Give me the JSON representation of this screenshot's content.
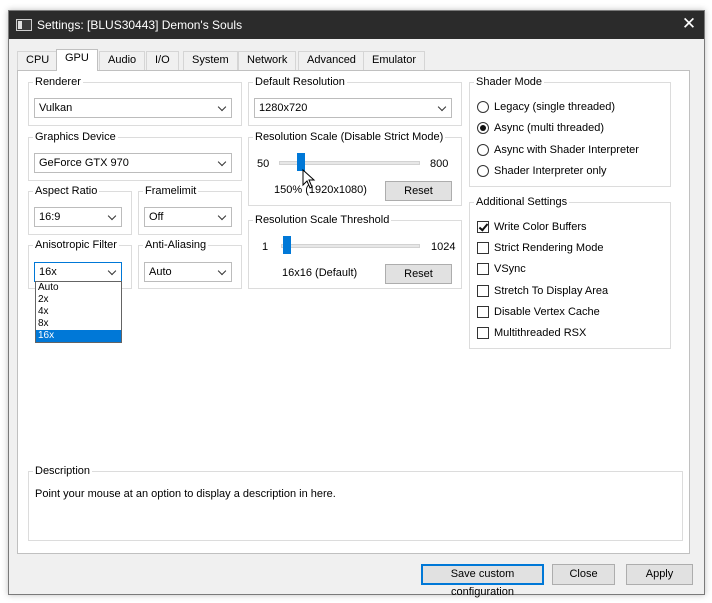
{
  "window": {
    "title": "Settings: [BLUS30443] Demon's Souls",
    "close_glyph": "✕"
  },
  "tabs": [
    {
      "label": "CPU"
    },
    {
      "label": "GPU",
      "active": true
    },
    {
      "label": "Audio"
    },
    {
      "label": "I/O"
    },
    {
      "label": "System"
    },
    {
      "label": "Network"
    },
    {
      "label": "Advanced"
    },
    {
      "label": "Emulator"
    }
  ],
  "renderer": {
    "legend": "Renderer",
    "value": "Vulkan"
  },
  "graphics_device": {
    "legend": "Graphics Device",
    "value": "GeForce GTX 970"
  },
  "aspect_ratio": {
    "legend": "Aspect Ratio",
    "value": "16:9"
  },
  "framelimit": {
    "legend": "Framelimit",
    "value": "Off"
  },
  "anisotropic_filter": {
    "legend": "Anisotropic Filter",
    "value": "16x",
    "options": [
      "Auto",
      "2x",
      "4x",
      "8x",
      "16x"
    ],
    "selected_index": 4
  },
  "anti_aliasing": {
    "legend": "Anti-Aliasing",
    "value": "Auto"
  },
  "default_resolution": {
    "legend": "Default Resolution",
    "value": "1280x720"
  },
  "resolution_scale": {
    "legend": "Resolution Scale (Disable Strict Mode)",
    "min_label": "50",
    "max_label": "800",
    "min": 50,
    "max": 800,
    "value": 150,
    "value_label": "150% (1920x1080)",
    "reset_label": "Reset"
  },
  "resolution_scale_threshold": {
    "legend": "Resolution Scale Threshold",
    "min_label": "1",
    "max_label": "1024",
    "min": 1,
    "max": 1024,
    "value": 16,
    "value_label": "16x16 (Default)",
    "reset_label": "Reset"
  },
  "shader_mode": {
    "legend": "Shader Mode",
    "options": [
      {
        "label": "Legacy (single threaded)",
        "selected": false
      },
      {
        "label": "Async (multi threaded)",
        "selected": true
      },
      {
        "label": "Async with Shader Interpreter",
        "selected": false
      },
      {
        "label": "Shader Interpreter only",
        "selected": false
      }
    ]
  },
  "additional_settings": {
    "legend": "Additional Settings",
    "items": [
      {
        "label": "Write Color Buffers",
        "checked": true
      },
      {
        "label": "Strict Rendering Mode",
        "checked": false
      },
      {
        "label": "VSync",
        "checked": false
      },
      {
        "label": "Stretch To Display Area",
        "checked": false
      },
      {
        "label": "Disable Vertex Cache",
        "checked": false
      },
      {
        "label": "Multithreaded RSX",
        "checked": false
      }
    ]
  },
  "description": {
    "legend": "Description",
    "text": "Point your mouse at an option to display a description in here."
  },
  "footer": {
    "save_label": "Save custom configuration",
    "close_label": "Close",
    "apply_label": "Apply"
  }
}
